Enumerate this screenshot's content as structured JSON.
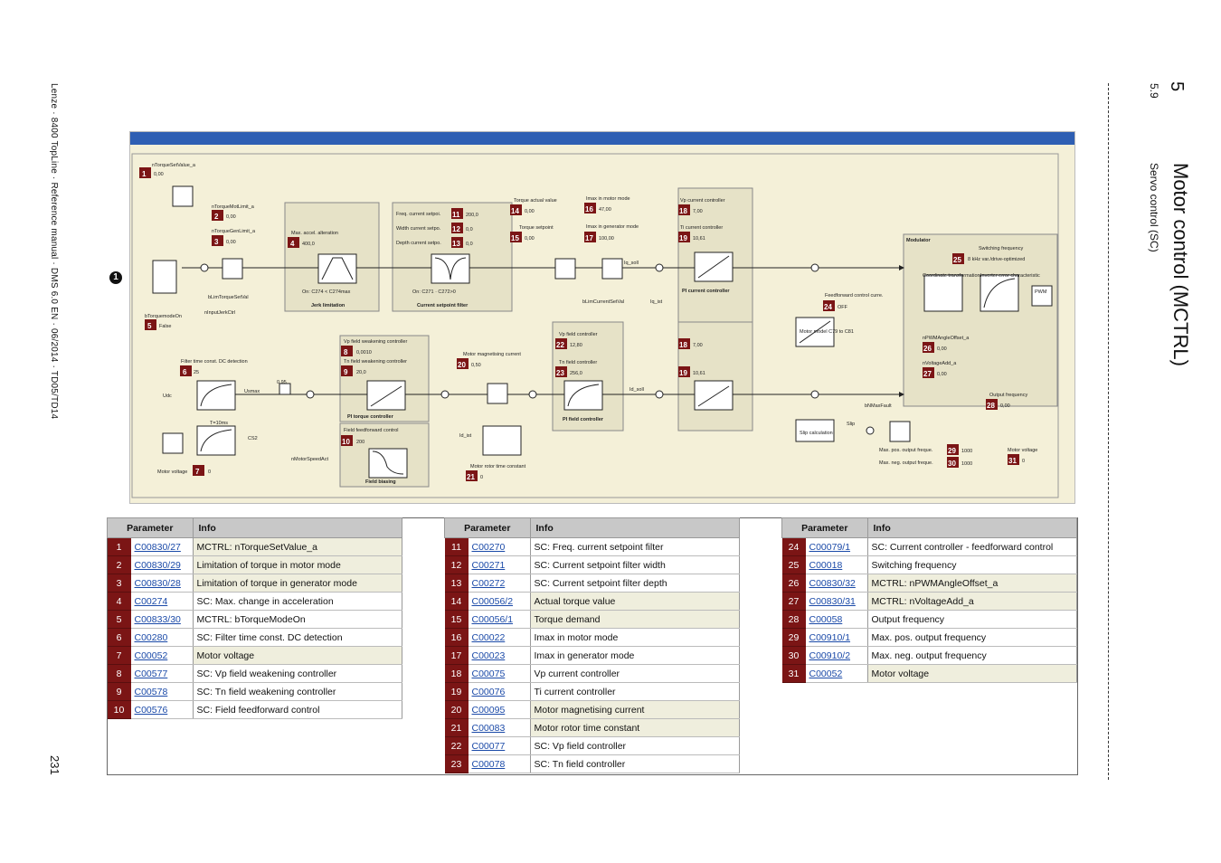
{
  "sidebar_left": "Lenze · 8400 TopLine · Reference manual · DMS 6.0 EN · 06/2014 · TD05/TD14",
  "page_number": "231",
  "header": {
    "chapter_number": "5",
    "chapter_title": "Motor control (MCTRL)",
    "section_number": "5.9",
    "section_title": "Servo control (SC)"
  },
  "diagram": {
    "marker": "1",
    "labels": {
      "nTorqueSetValue_a": "nTorqueSetValue_a",
      "nTorqueMotLimit_a": "nTorqueMotLimit_a",
      "nTorqueGenLimit_a": "nTorqueGenLimit_a",
      "max_accel": "Max. accel. alteration",
      "jerk": "Jerk limitation",
      "jerk_on": "On: C274 < C274max",
      "freq_setpoint": "Freq. current setpoi.",
      "width_setpoint": "Width current setpo.",
      "depth_setpoint": "Depth current setpo.",
      "csf": "Current setpoint filter",
      "csf_on": "On: C271 · C272>0",
      "torque_actual": "Torque actual value",
      "torque_setpoint": "Torque setpoint",
      "imax_motor": "Imax in motor mode",
      "imax_gen": "Imax in generator mode",
      "vp_current": "Vp current controller",
      "ti_current": "Ti current controller",
      "pi_current": "PI current controller",
      "modulator": "Modulator",
      "switching_freq": "Switching frequency",
      "switching_value": "8 kHz var./drive-optimized",
      "coord": "Coordinate transformation",
      "inverter": "Inverter error characteristic",
      "pwm": "PWM",
      "ff_control": "Feedforward control curre.",
      "ff_value": "OFF",
      "motor_model": "Motor model C79 to C81",
      "pwm_angle": "nPWMAngleOffset_a",
      "voltage_add": "nVoltageAdd_a",
      "output_freq": "Output frequency",
      "slip_calc": "Slip calculation",
      "max_pos": "Max. pos. output freque.",
      "max_neg": "Max. neg. output freque.",
      "motor_voltage_r": "Motor voltage",
      "bTorquemodeOn": "bTorquemodeOn",
      "false": "False",
      "filter_tc": "Filter time const. DC detection",
      "vp_field_weak": "Vp field weakening controller",
      "tn_field_weak": "Tn field weakening controller",
      "pi_torque": "PI torque controller",
      "field_ff": "Field feedforward control",
      "field_bias": "Field biasing",
      "motor_mag": "Motor magnetising current",
      "vp_field": "Vp field controller",
      "tn_field": "Tn field controller",
      "pi_field": "PI field controller",
      "rotor_tc": "Motor rotor time constant",
      "motor_voltage_l": "Motor voltage",
      "udc": "Udc",
      "usmax": "Usmax",
      "t10": "T=10ms",
      "cs2": "CS2",
      "nMotorSpeedAct": "nMotorSpeedAct",
      "id_ist": "Id_ist",
      "iq_ist": "Iq_ist",
      "iq_soll": "Iq_soll",
      "id_soll": "Id_soll",
      "bLimTorqueSetVal": "bLimTorqueSetVal",
      "nInputJerkCtrl": "nInputJerkCtrl",
      "bLimCurrentSetVal": "bLimCurrentSetVal",
      "bNMaxFault": "bNMaxFault",
      "val_095": "0.95",
      "slip": "Slip"
    },
    "values": {
      "p1": "0,00",
      "p2": "0,00",
      "p3": "0,00",
      "p4": "400,0",
      "p6": "25",
      "p7": "0",
      "p8": "0,0010",
      "p9": "20,0",
      "p10": "200",
      "p11": "200,0",
      "p12": "0,0",
      "p13": "0,0",
      "p14": "0,00",
      "p15": "0,00",
      "p16": "47,00",
      "p17": "100,00",
      "p18a": "7,00",
      "p19a": "10,61",
      "p18b": "7,00",
      "p19b": "10,61",
      "p20": "0,50",
      "p21": "0",
      "p22": "12,80",
      "p23": "256,0",
      "p24": "OFF",
      "p26": "0,00",
      "p27": "0,00",
      "p28": "0,00",
      "p29": "1000",
      "p30": "1000",
      "p31": "0"
    }
  },
  "tables": [
    {
      "headers": [
        "Parameter",
        "Info"
      ],
      "rows": [
        {
          "n": "1",
          "code": "C00830/27",
          "info": "MCTRL: nTorqueSetValue_a"
        },
        {
          "n": "2",
          "code": "C00830/29",
          "info": "Limitation of torque in motor mode"
        },
        {
          "n": "3",
          "code": "C00830/28",
          "info": "Limitation of torque in generator mode"
        },
        {
          "n": "4",
          "code": "C00274",
          "info": "SC: Max. change in acceleration"
        },
        {
          "n": "5",
          "code": "C00833/30",
          "info": "MCTRL: bTorqueModeOn"
        },
        {
          "n": "6",
          "code": "C00280",
          "info": "SC: Filter time const. DC detection"
        },
        {
          "n": "7",
          "code": "C00052",
          "info": "Motor voltage"
        },
        {
          "n": "8",
          "code": "C00577",
          "info": "SC: Vp field weakening controller"
        },
        {
          "n": "9",
          "code": "C00578",
          "info": "SC: Tn field weakening controller"
        },
        {
          "n": "10",
          "code": "C00576",
          "info": "SC: Field feedforward control"
        }
      ]
    },
    {
      "headers": [
        "Parameter",
        "Info"
      ],
      "rows": [
        {
          "n": "11",
          "code": "C00270",
          "info": "SC: Freq. current setpoint filter"
        },
        {
          "n": "12",
          "code": "C00271",
          "info": "SC: Current setpoint filter width"
        },
        {
          "n": "13",
          "code": "C00272",
          "info": "SC: Current setpoint filter depth"
        },
        {
          "n": "14",
          "code": "C00056/2",
          "info": "Actual torque value"
        },
        {
          "n": "15",
          "code": "C00056/1",
          "info": "Torque demand"
        },
        {
          "n": "16",
          "code": "C00022",
          "info": "Imax in motor mode"
        },
        {
          "n": "17",
          "code": "C00023",
          "info": "Imax in generator mode"
        },
        {
          "n": "18",
          "code": "C00075",
          "info": "Vp current controller"
        },
        {
          "n": "19",
          "code": "C00076",
          "info": "Ti current controller"
        },
        {
          "n": "20",
          "code": "C00095",
          "info": "Motor magnetising current"
        },
        {
          "n": "21",
          "code": "C00083",
          "info": "Motor rotor time constant"
        },
        {
          "n": "22",
          "code": "C00077",
          "info": "SC: Vp field controller"
        },
        {
          "n": "23",
          "code": "C00078",
          "info": "SC: Tn field controller"
        }
      ]
    },
    {
      "headers": [
        "Parameter",
        "Info"
      ],
      "rows": [
        {
          "n": "24",
          "code": "C00079/1",
          "info": "SC: Current controller - feedforward control"
        },
        {
          "n": "25",
          "code": "C00018",
          "info": "Switching frequency"
        },
        {
          "n": "26",
          "code": "C00830/32",
          "info": "MCTRL: nPWMAngleOffset_a"
        },
        {
          "n": "27",
          "code": "C00830/31",
          "info": "MCTRL: nVoltageAdd_a"
        },
        {
          "n": "28",
          "code": "C00058",
          "info": "Output frequency"
        },
        {
          "n": "29",
          "code": "C00910/1",
          "info": "Max. pos. output frequency"
        },
        {
          "n": "30",
          "code": "C00910/2",
          "info": "Max. neg. output frequency"
        },
        {
          "n": "31",
          "code": "C00052",
          "info": "Motor voltage"
        }
      ]
    }
  ]
}
